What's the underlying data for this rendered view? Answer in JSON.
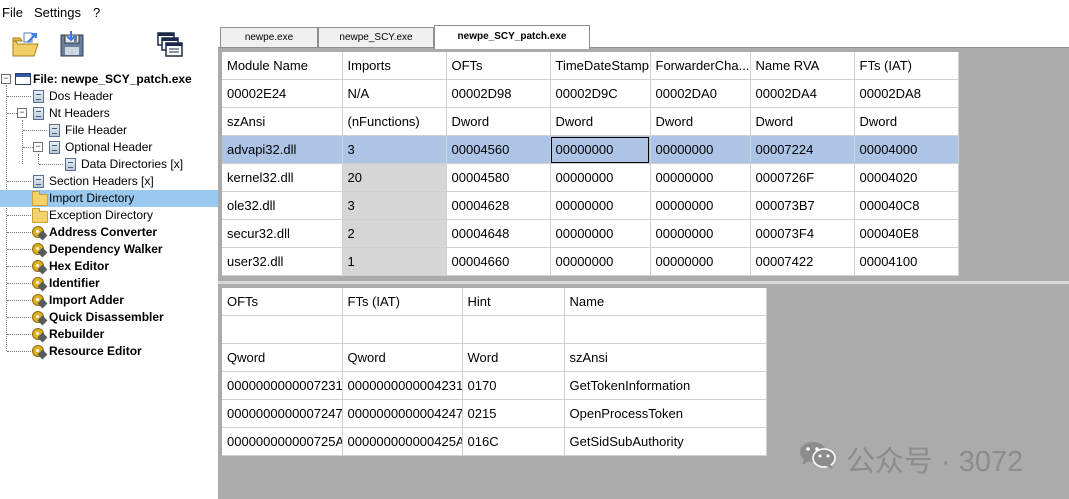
{
  "menu": {
    "file": "File",
    "settings": "Settings",
    "help": "?"
  },
  "toolbar": {
    "icons": [
      "open-file-icon",
      "save-file-icon",
      "windows-icon"
    ]
  },
  "tree": {
    "items": [
      {
        "label": "File: newpe_SCY_patch.exe",
        "icon": "window-icon"
      },
      {
        "label": "Dos Header",
        "icon": "document-icon"
      },
      {
        "label": "Nt Headers",
        "icon": "document-icon"
      },
      {
        "label": "File Header",
        "icon": "document-icon"
      },
      {
        "label": "Optional Header",
        "icon": "document-icon"
      },
      {
        "label": "Data Directories [x]",
        "icon": "document-icon"
      },
      {
        "label": "Section Headers [x]",
        "icon": "document-icon"
      },
      {
        "label": "Import Directory",
        "icon": "folder-icon"
      },
      {
        "label": "Exception Directory",
        "icon": "folder-icon"
      },
      {
        "label": "Address Converter",
        "icon": "tool-icon"
      },
      {
        "label": "Dependency Walker",
        "icon": "tool-icon"
      },
      {
        "label": "Hex Editor",
        "icon": "tool-icon"
      },
      {
        "label": "Identifier",
        "icon": "tool-icon"
      },
      {
        "label": "Import Adder",
        "icon": "tool-icon"
      },
      {
        "label": "Quick Disassembler",
        "icon": "tool-icon"
      },
      {
        "label": "Rebuilder",
        "icon": "tool-icon"
      },
      {
        "label": "Resource Editor",
        "icon": "tool-icon"
      }
    ]
  },
  "tabs": [
    "newpe.exe",
    "newpe_SCY.exe",
    "newpe_SCY_patch.exe"
  ],
  "imports_table": {
    "headers": [
      "Module Name",
      "Imports",
      "OFTs",
      "TimeDateStamp",
      "ForwarderCha...",
      "Name RVA",
      "FTs (IAT)"
    ],
    "offsets": [
      "00002E24",
      "N/A",
      "00002D98",
      "00002D9C",
      "00002DA0",
      "00002DA4",
      "00002DA8"
    ],
    "types": [
      "szAnsi",
      "(nFunctions)",
      "Dword",
      "Dword",
      "Dword",
      "Dword",
      "Dword"
    ],
    "rows": [
      [
        "advapi32.dll",
        "3",
        "00004560",
        "00000000",
        "00000000",
        "00007224",
        "00004000"
      ],
      [
        "kernel32.dll",
        "20",
        "00004580",
        "00000000",
        "00000000",
        "0000726F",
        "00004020"
      ],
      [
        "ole32.dll",
        "3",
        "00004628",
        "00000000",
        "00000000",
        "000073B7",
        "000040C8"
      ],
      [
        "secur32.dll",
        "2",
        "00004648",
        "00000000",
        "00000000",
        "000073F4",
        "000040E8"
      ],
      [
        "user32.dll",
        "1",
        "00004660",
        "00000000",
        "00000000",
        "00007422",
        "00004100"
      ]
    ]
  },
  "functions_table": {
    "headers": [
      "OFTs",
      "FTs (IAT)",
      "Hint",
      "Name"
    ],
    "offsets": [
      "",
      "",
      "",
      ""
    ],
    "types": [
      "Qword",
      "Qword",
      "Word",
      "szAnsi"
    ],
    "rows": [
      [
        "0000000000007231",
        "0000000000004231",
        "0170",
        "GetTokenInformation"
      ],
      [
        "0000000000007247",
        "0000000000004247",
        "0215",
        "OpenProcessToken"
      ],
      [
        "000000000000725A",
        "000000000000425A",
        "016C",
        "GetSidSubAuthority"
      ]
    ]
  },
  "watermark": {
    "text": "公众号 · 3072",
    "icon": "wechat-icon"
  }
}
